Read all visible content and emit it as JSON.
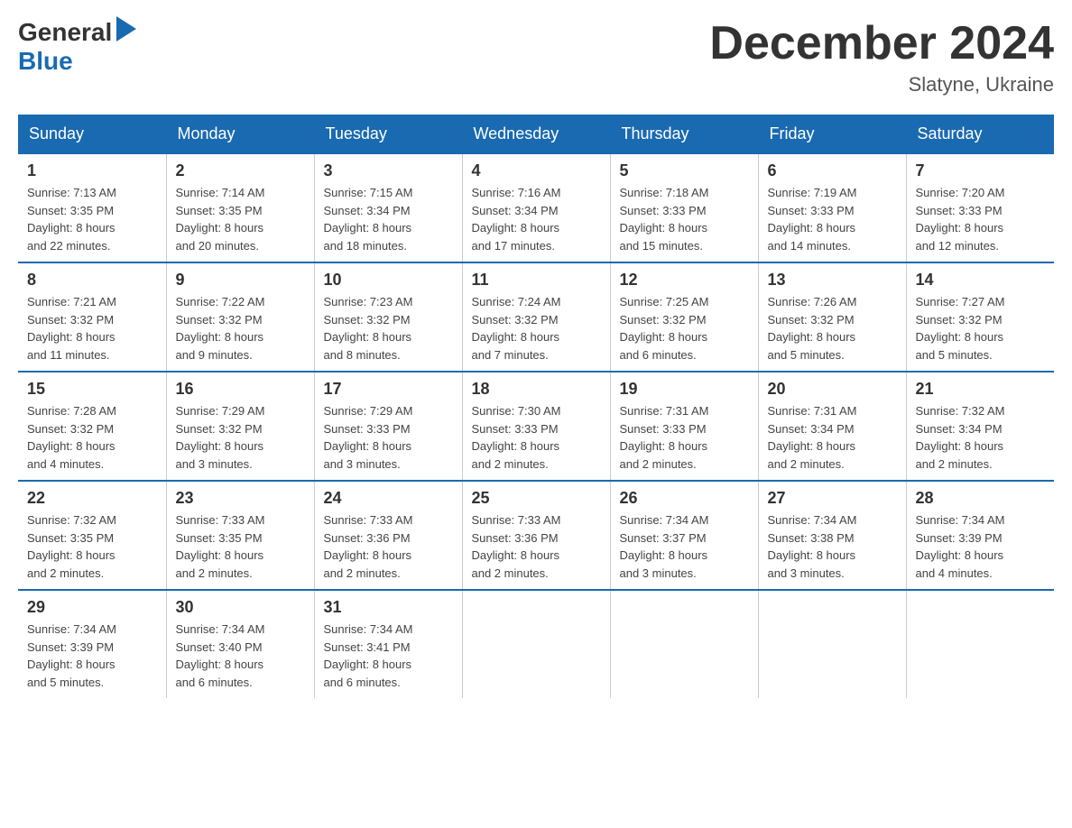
{
  "header": {
    "title": "December 2024",
    "location": "Slatyne, Ukraine"
  },
  "days_of_week": [
    "Sunday",
    "Monday",
    "Tuesday",
    "Wednesday",
    "Thursday",
    "Friday",
    "Saturday"
  ],
  "weeks": [
    [
      {
        "day": "1",
        "sunrise": "7:13 AM",
        "sunset": "3:35 PM",
        "daylight": "8 hours and 22 minutes."
      },
      {
        "day": "2",
        "sunrise": "7:14 AM",
        "sunset": "3:35 PM",
        "daylight": "8 hours and 20 minutes."
      },
      {
        "day": "3",
        "sunrise": "7:15 AM",
        "sunset": "3:34 PM",
        "daylight": "8 hours and 18 minutes."
      },
      {
        "day": "4",
        "sunrise": "7:16 AM",
        "sunset": "3:34 PM",
        "daylight": "8 hours and 17 minutes."
      },
      {
        "day": "5",
        "sunrise": "7:18 AM",
        "sunset": "3:33 PM",
        "daylight": "8 hours and 15 minutes."
      },
      {
        "day": "6",
        "sunrise": "7:19 AM",
        "sunset": "3:33 PM",
        "daylight": "8 hours and 14 minutes."
      },
      {
        "day": "7",
        "sunrise": "7:20 AM",
        "sunset": "3:33 PM",
        "daylight": "8 hours and 12 minutes."
      }
    ],
    [
      {
        "day": "8",
        "sunrise": "7:21 AM",
        "sunset": "3:32 PM",
        "daylight": "8 hours and 11 minutes."
      },
      {
        "day": "9",
        "sunrise": "7:22 AM",
        "sunset": "3:32 PM",
        "daylight": "8 hours and 9 minutes."
      },
      {
        "day": "10",
        "sunrise": "7:23 AM",
        "sunset": "3:32 PM",
        "daylight": "8 hours and 8 minutes."
      },
      {
        "day": "11",
        "sunrise": "7:24 AM",
        "sunset": "3:32 PM",
        "daylight": "8 hours and 7 minutes."
      },
      {
        "day": "12",
        "sunrise": "7:25 AM",
        "sunset": "3:32 PM",
        "daylight": "8 hours and 6 minutes."
      },
      {
        "day": "13",
        "sunrise": "7:26 AM",
        "sunset": "3:32 PM",
        "daylight": "8 hours and 5 minutes."
      },
      {
        "day": "14",
        "sunrise": "7:27 AM",
        "sunset": "3:32 PM",
        "daylight": "8 hours and 5 minutes."
      }
    ],
    [
      {
        "day": "15",
        "sunrise": "7:28 AM",
        "sunset": "3:32 PM",
        "daylight": "8 hours and 4 minutes."
      },
      {
        "day": "16",
        "sunrise": "7:29 AM",
        "sunset": "3:32 PM",
        "daylight": "8 hours and 3 minutes."
      },
      {
        "day": "17",
        "sunrise": "7:29 AM",
        "sunset": "3:33 PM",
        "daylight": "8 hours and 3 minutes."
      },
      {
        "day": "18",
        "sunrise": "7:30 AM",
        "sunset": "3:33 PM",
        "daylight": "8 hours and 2 minutes."
      },
      {
        "day": "19",
        "sunrise": "7:31 AM",
        "sunset": "3:33 PM",
        "daylight": "8 hours and 2 minutes."
      },
      {
        "day": "20",
        "sunrise": "7:31 AM",
        "sunset": "3:34 PM",
        "daylight": "8 hours and 2 minutes."
      },
      {
        "day": "21",
        "sunrise": "7:32 AM",
        "sunset": "3:34 PM",
        "daylight": "8 hours and 2 minutes."
      }
    ],
    [
      {
        "day": "22",
        "sunrise": "7:32 AM",
        "sunset": "3:35 PM",
        "daylight": "8 hours and 2 minutes."
      },
      {
        "day": "23",
        "sunrise": "7:33 AM",
        "sunset": "3:35 PM",
        "daylight": "8 hours and 2 minutes."
      },
      {
        "day": "24",
        "sunrise": "7:33 AM",
        "sunset": "3:36 PM",
        "daylight": "8 hours and 2 minutes."
      },
      {
        "day": "25",
        "sunrise": "7:33 AM",
        "sunset": "3:36 PM",
        "daylight": "8 hours and 2 minutes."
      },
      {
        "day": "26",
        "sunrise": "7:34 AM",
        "sunset": "3:37 PM",
        "daylight": "8 hours and 3 minutes."
      },
      {
        "day": "27",
        "sunrise": "7:34 AM",
        "sunset": "3:38 PM",
        "daylight": "8 hours and 3 minutes."
      },
      {
        "day": "28",
        "sunrise": "7:34 AM",
        "sunset": "3:39 PM",
        "daylight": "8 hours and 4 minutes."
      }
    ],
    [
      {
        "day": "29",
        "sunrise": "7:34 AM",
        "sunset": "3:39 PM",
        "daylight": "8 hours and 5 minutes."
      },
      {
        "day": "30",
        "sunrise": "7:34 AM",
        "sunset": "3:40 PM",
        "daylight": "8 hours and 6 minutes."
      },
      {
        "day": "31",
        "sunrise": "7:34 AM",
        "sunset": "3:41 PM",
        "daylight": "8 hours and 6 minutes."
      },
      null,
      null,
      null,
      null
    ]
  ],
  "labels": {
    "sunrise": "Sunrise:",
    "sunset": "Sunset:",
    "daylight": "Daylight:"
  }
}
